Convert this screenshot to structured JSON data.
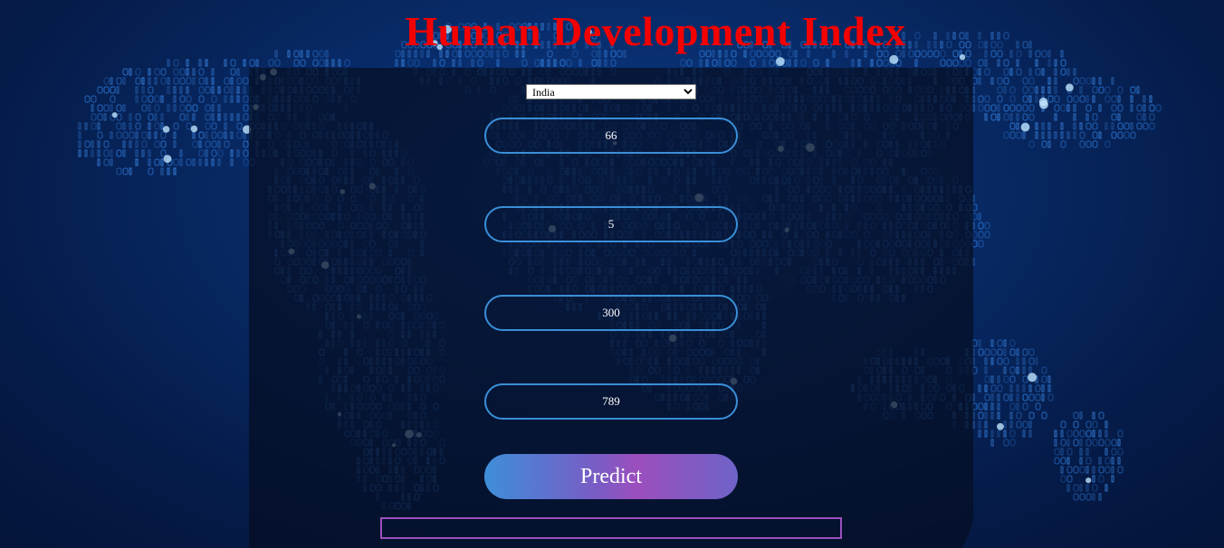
{
  "page": {
    "title": "Human Development Index"
  },
  "form": {
    "country": {
      "selected": "India",
      "options": [
        "India"
      ]
    },
    "fields": [
      {
        "value": "66"
      },
      {
        "value": "5"
      },
      {
        "value": "300"
      },
      {
        "value": "789"
      }
    ],
    "predict_label": "Predict",
    "result_text": ""
  },
  "colors": {
    "title": "#f40000",
    "field_border": "#3a8fd8",
    "result_border": "#9b4fbd",
    "button_gradient_start": "#3e8ed9",
    "button_gradient_end": "#9b4fbd"
  },
  "background": {
    "icon": "binary-world-map"
  }
}
